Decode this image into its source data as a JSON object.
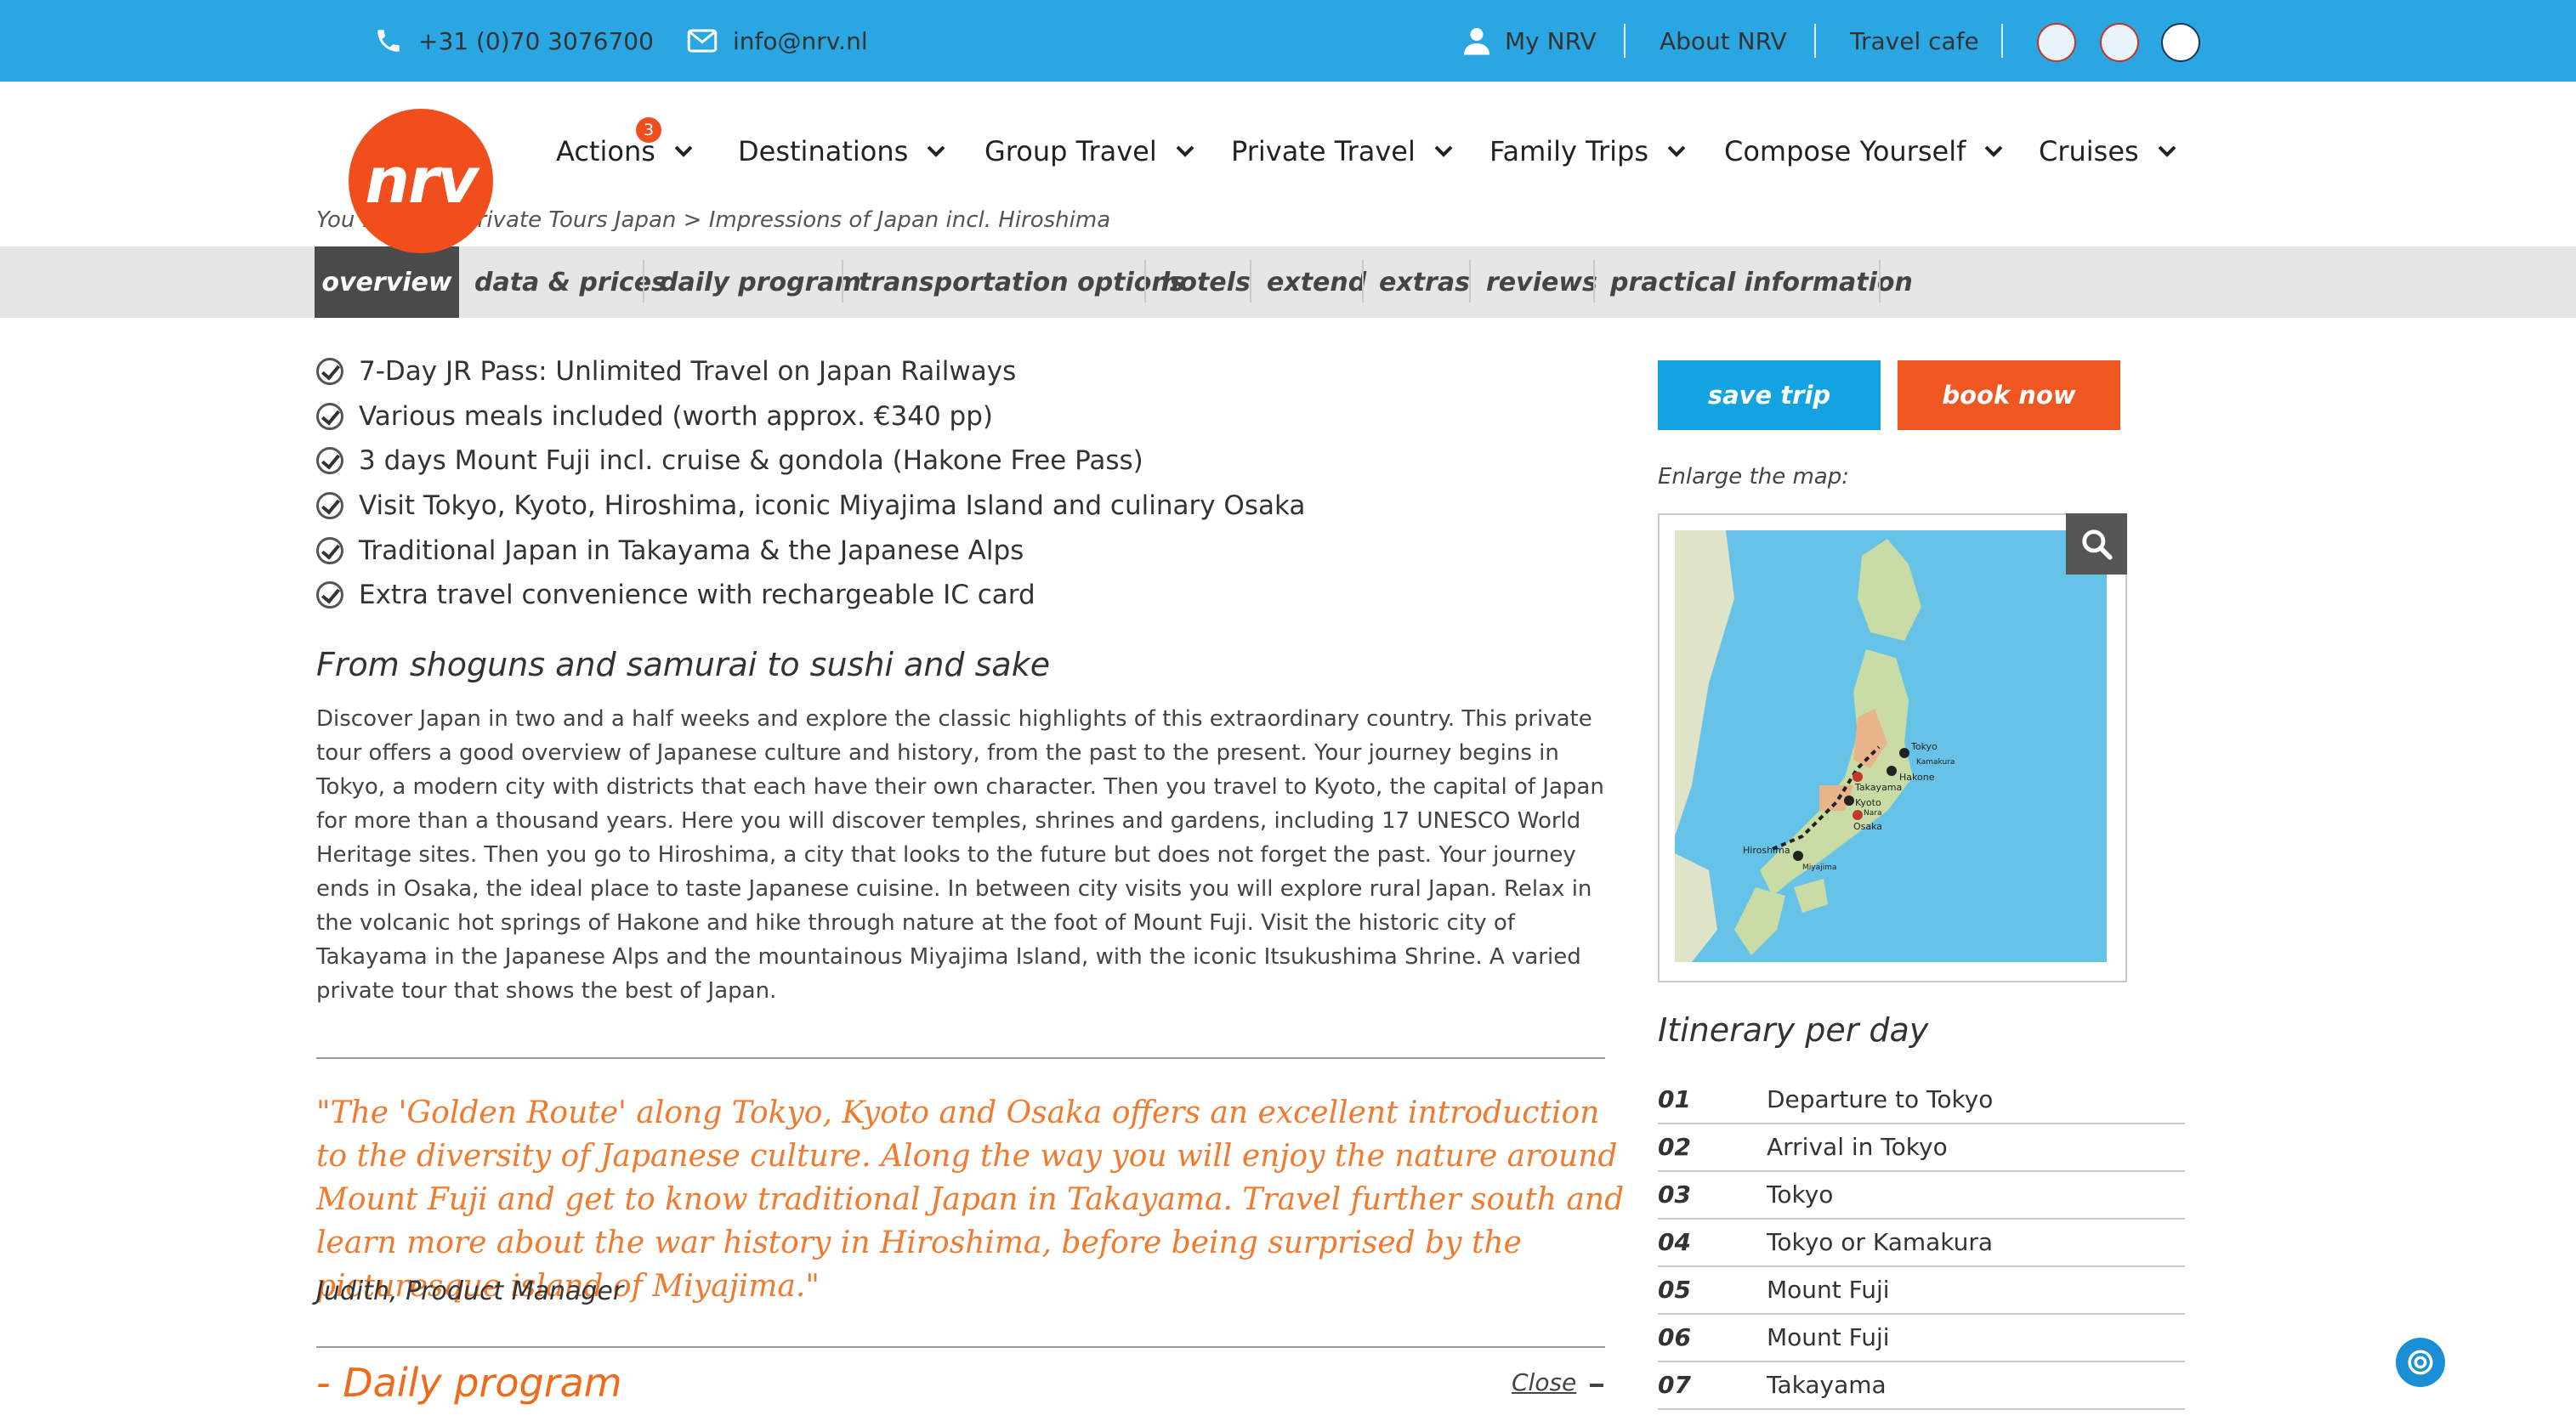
{
  "topbar": {
    "phone": "+31 (0)70 3076700",
    "email": "info@nrv.nl",
    "my_nrv": "My NRV",
    "about": "About NRV",
    "travel_cafe": "Travel cafe"
  },
  "logo": {
    "text": "nrv"
  },
  "menu": {
    "actions": "Actions",
    "actions_badge": "3",
    "destinations": "Destinations",
    "group_travel": "Group Travel",
    "private_travel": "Private Travel",
    "family_trips": "Family Trips",
    "compose_yourself": "Compose Yourself",
    "cruises": "Cruises"
  },
  "breadcrumb": "You ... pan > Private Tours Japan > Impressions of Japan incl. Hiroshima",
  "tabs": [
    "overview",
    "data & prices",
    "daily program",
    "transportation options",
    "hotels",
    "extend",
    "extras",
    "reviews",
    "practical information"
  ],
  "highlights": [
    "7-Day JR Pass: Unlimited Travel on Japan Railways",
    "Various meals included (worth approx. €340 pp)",
    "3 days Mount Fuji incl. cruise & gondola (Hakone Free Pass)",
    "Visit Tokyo, Kyoto, Hiroshima, iconic Miyajima Island and culinary Osaka",
    "Traditional Japan in Takayama & the Japanese Alps",
    "Extra travel convenience with rechargeable IC card"
  ],
  "intro": {
    "heading": "From shoguns and samurai to sushi and sake",
    "body": "Discover Japan in two and a half weeks and explore the classic highlights of this extraordinary country. This private tour offers a good overview of Japanese culture and history, from the past to the present. Your journey begins in Tokyo, a modern city with districts that each have their own character. Then you travel to Kyoto, the capital of Japan for more than a thousand years. Here you will discover temples, shrines and gardens, including 17 UNESCO World Heritage sites. Then you go to Hiroshima, a city that looks to the future but does not forget the past. Your journey ends in Osaka, the ideal place to taste Japanese cuisine. In between city visits you will explore rural Japan. Relax in the volcanic hot springs of Hakone and hike through nature at the foot of Mount Fuji. Visit the historic city of Takayama in the Japanese Alps and the mountainous Miyajima Island, with the iconic Itsukushima Shrine. A varied private tour that shows the best of Japan."
  },
  "quote": {
    "text": "\"The 'Golden Route' along Tokyo, Kyoto and Osaka offers an excellent introduction to the diversity of Japanese culture. Along the way you will enjoy the nature around Mount Fuji and get to know traditional Japan in Takayama. Travel further south and learn more about the war history in Hiroshima, before being surprised by the picturesque island of Miyajima.\"",
    "author": "Judith, Product Manager"
  },
  "daily_program": {
    "title": "-  Daily program",
    "close": "Close"
  },
  "sidebar": {
    "save_trip": "save trip",
    "book_now": "book now",
    "map_label": "Enlarge the map:",
    "map_cities": [
      "Tokyo",
      "Hakone",
      "Kamakura",
      "Takayama",
      "Kyoto",
      "Nara",
      "Osaka",
      "Hiroshima",
      "Miyajima"
    ],
    "itinerary_title": "Itinerary per day",
    "itinerary": [
      {
        "day": "01",
        "place": "Departure to Tokyo"
      },
      {
        "day": "02",
        "place": "Arrival in Tokyo"
      },
      {
        "day": "03",
        "place": "Tokyo"
      },
      {
        "day": "04",
        "place": "Tokyo or Kamakura"
      },
      {
        "day": "05",
        "place": "Mount Fuji"
      },
      {
        "day": "06",
        "place": "Mount Fuji"
      },
      {
        "day": "07",
        "place": "Takayama"
      }
    ]
  },
  "colors": {
    "topbar": "#2aa7e3",
    "brand": "#f04e1c",
    "save": "#13a3e0",
    "book": "#f05620",
    "quote": "#f07a2e"
  }
}
